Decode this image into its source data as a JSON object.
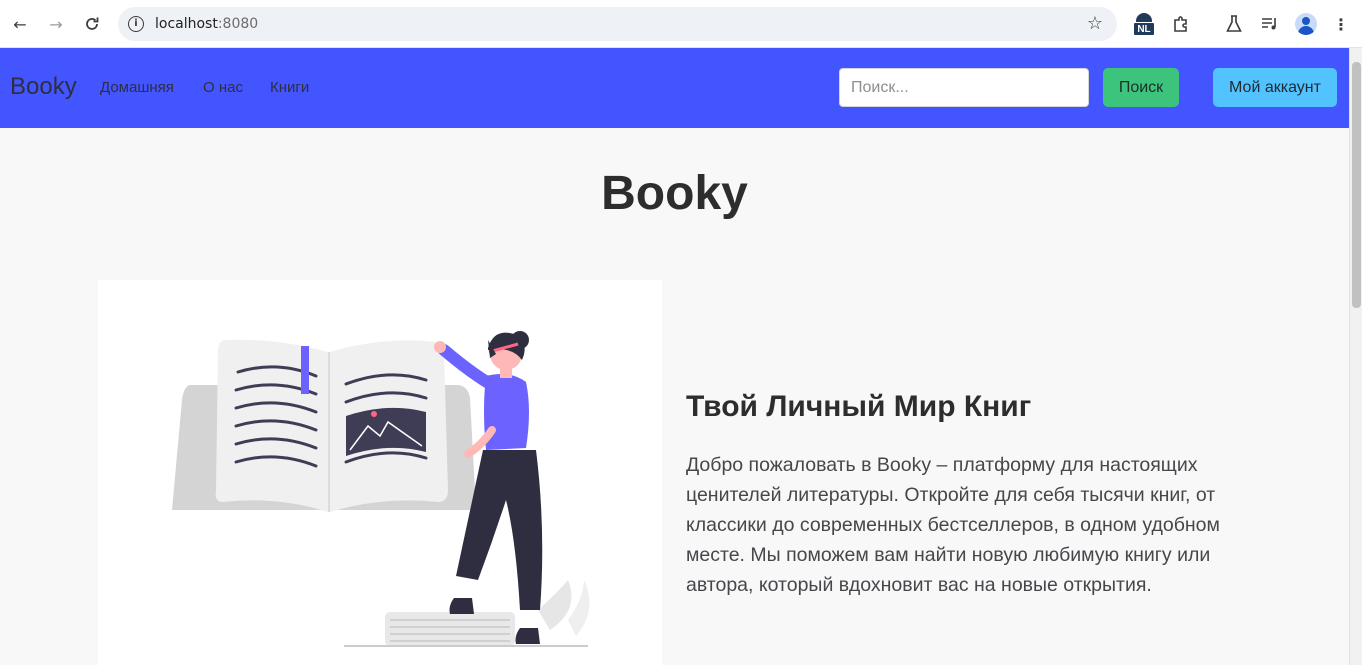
{
  "browser": {
    "url_host": "localhost",
    "url_port": ":8080",
    "ext_badge": "NL"
  },
  "colors": {
    "nav_bg": "#4355ff",
    "search_button": "#3cc47c",
    "account_button": "#53c3ff",
    "illustration_accent": "#6c63ff"
  },
  "navbar": {
    "brand": "Booky",
    "links": [
      "Домашняя",
      "О нас",
      "Книги"
    ],
    "search_placeholder": "Поиск...",
    "search_button": "Поиск",
    "account_button": "Мой аккаунт"
  },
  "main": {
    "title": "Booky",
    "hero": {
      "heading": "Твой Личный Мир Книг",
      "text": "Добро пожаловать в Booky – платформу для настоящих ценителей литературы. Откройте для себя тысячи книг, от классики до современных бестселлеров, в одном удобном месте. Мы поможем вам найти новую любимую книгу или автора, который вдохновит вас на новые открытия."
    }
  }
}
